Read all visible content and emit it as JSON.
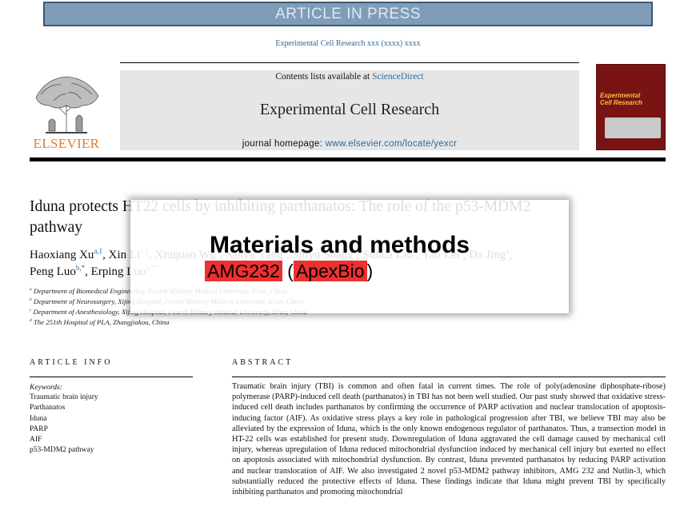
{
  "banner": "ARTICLE IN PRESS",
  "journal_ref": "Experimental Cell Research xxx (xxxx) xxxx",
  "masthead": {
    "contents_prefix": "Contents lists available at ",
    "contents_link": "ScienceDirect",
    "journal_title": "Experimental Cell Research",
    "homepage_prefix": "journal homepage: ",
    "homepage_url": "www.elsevier.com/locate/yexcr"
  },
  "publisher": "ELSEVIER",
  "cover": {
    "title_line1": "Experimental",
    "title_line2": "Cell Research"
  },
  "article": {
    "title": "Iduna protects HT22 cells by inhibiting parthanatos: The role of the p53-MDM2 pathway",
    "authors_line1": [
      {
        "name": "Haoxiang Xu",
        "sup": "a,1"
      },
      {
        "name": "Xin Li",
        "sup": "c,1"
      },
      {
        "name": "Xiuquan Wu",
        "sup": "b"
      },
      {
        "name": "Xinyu Yang",
        "sup": "b"
      },
      {
        "name": "Shiyu Shang",
        "sup": "b"
      },
      {
        "name": "Suhua Liu",
        "sup": "b"
      },
      {
        "name": "Yao Lei",
        "sup": "a"
      },
      {
        "name": "Da Jing",
        "sup": "a"
      }
    ],
    "authors_line2": [
      {
        "name": "Peng Luo",
        "sup": "b,*"
      },
      {
        "name": "Erping Luo",
        "sup": "a,**"
      }
    ],
    "affiliations": [
      {
        "sup": "a",
        "text": "Department of Biomedical Engineering, Fourth Military Medical University, Xi'an, China"
      },
      {
        "sup": "b",
        "text": "Department of Neurosurgery, Xijing Hospital, Fourth Military Medical University, Xi'an, China"
      },
      {
        "sup": "c",
        "text": "Department of Anesthesiology, Xijing Hospital, Fourth Military Medical University, Xi'an, China"
      },
      {
        "sup": "d",
        "text": "The 251th Hospital of PLA, Zhangjiakou, China"
      }
    ]
  },
  "overlay": {
    "heading": "Materials and methods",
    "product": "AMG232",
    "paren_open": " (",
    "supplier": "ApexBio",
    "paren_close": ")",
    "highlight_color": "#ee3030"
  },
  "article_info": {
    "heading": "ARTICLE INFO",
    "keywords_label": "Keywords:",
    "keywords": [
      "Traumatic brain injury",
      "Parthanatos",
      "Iduna",
      "PARP",
      "AIF",
      "p53-MDM2 pathway"
    ]
  },
  "abstract": {
    "heading": "ABSTRACT",
    "text": "Traumatic brain injury (TBI) is common and often fatal in current times. The role of poly(adenosine diphosphate-ribose) polymerase (PARP)-induced cell death (parthanatos) in TBI has not been well studied. Our past study showed that oxidative stress-induced cell death includes parthanatos by confirming the occurrence of PARP activation and nuclear translocation of apoptosis-inducing factor (AIF). As oxidative stress plays a key role in pathological progression after TBI, we believe TBI may also be alleviated by the expression of Iduna, which is the only known endogenous regulator of parthanatos. Thus, a transection model in HT-22 cells was established for present study. Downregulation of Iduna aggravated the cell damage caused by mechanical cell injury, whereas upregulation of Iduna reduced mitochondrial dysfunction induced by mechanical cell injury but exerted no effect on apoptosis associated with mitochondrial dysfunction. By contrast, Iduna prevented parthanatos by reducing PARP activation and nuclear translocation of AIF. We also investigated 2 novel p53-MDM2 pathway inhibitors, AMG 232 and Nutlin-3, which substantially reduced the protective effects of Iduna. These findings indicate that Iduna might prevent TBI by specifically inhibiting parthanatos and promoting mitochondrial"
  }
}
